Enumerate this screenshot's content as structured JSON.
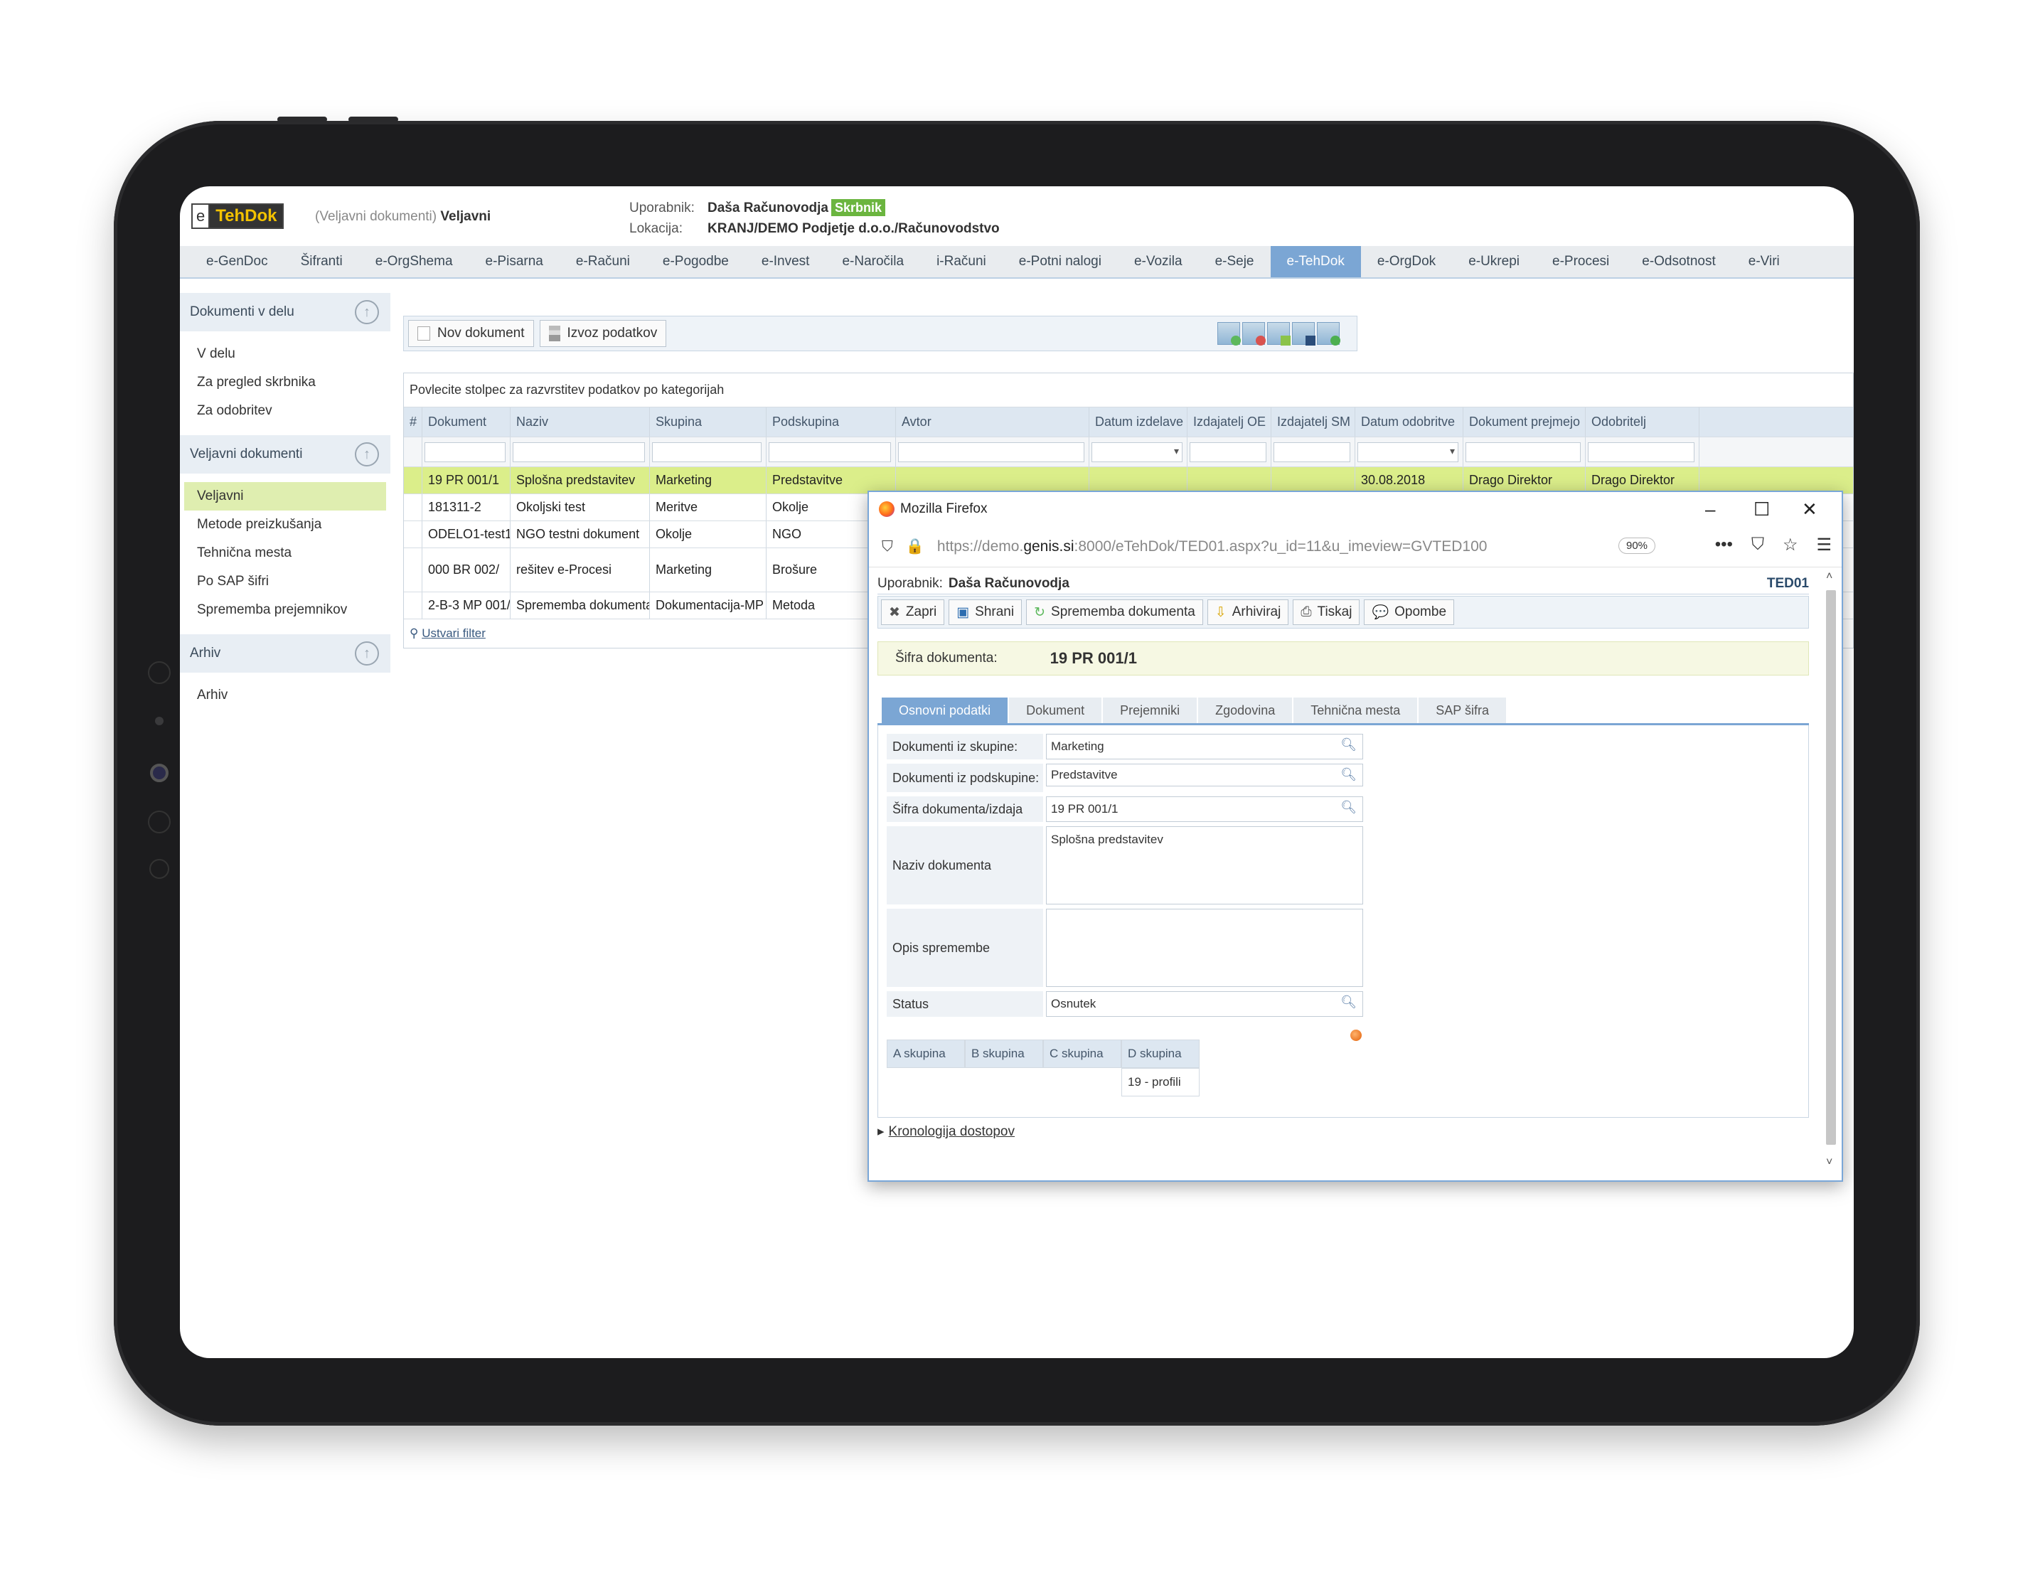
{
  "header": {
    "logo_e": "e",
    "logo_text": "TehDok",
    "context_prefix": "(Veljavni dokumenti)",
    "context_title": "Veljavni",
    "user_label": "Uporabnik:",
    "user_name": "Daša Računovodja",
    "user_role": "Skrbnik",
    "location_label": "Lokacija:",
    "location_value": "KRANJ/DEMO Podjetje d.o.o./Računovodstvo"
  },
  "menu": [
    "e-GenDoc",
    "Šifranti",
    "e-OrgShema",
    "e-Pisarna",
    "e-Računi",
    "e-Pogodbe",
    "e-Invest",
    "e-Naročila",
    "i-Računi",
    "e-Potni nalogi",
    "e-Vozila",
    "e-Seje",
    "e-TehDok",
    "e-OrgDok",
    "e-Ukrepi",
    "e-Procesi",
    "e-Odsotnost",
    "e-Viri"
  ],
  "active_menu": "e-TehDok",
  "sidebar": {
    "sections": [
      {
        "title": "Dokumenti v delu",
        "items": [
          "V delu",
          "Za pregled skrbnika",
          "Za odobritev"
        ]
      },
      {
        "title": "Veljavni dokumenti",
        "items": [
          "Veljavni",
          "Metode preizkušanja",
          "Tehnična mesta",
          "Po SAP šifri",
          "Sprememba prejemnikov"
        ]
      },
      {
        "title": "Arhiv",
        "items": [
          "Arhiv"
        ]
      }
    ],
    "active_item": "Veljavni"
  },
  "toolbar": {
    "new_doc": "Nov dokument",
    "export": "Izvoz podatkov"
  },
  "grid": {
    "group_hint": "Povlecite stolpec za razvrstitev podatkov po kategorijah",
    "columns": [
      "#",
      "Dokument",
      "Naziv",
      "Skupina",
      "Podskupina",
      "Avtor",
      "Datum izdelave",
      "Izdajatelj OE",
      "Izdajatelj SM",
      "Datum odobritve",
      "Dokument prejmejo",
      "Odobritelj"
    ],
    "rows": [
      [
        "",
        "19 PR 001/1",
        "Splošna predstavitev",
        "Marketing",
        "Predstavitve",
        "",
        "",
        "",
        "",
        "30.08.2018",
        "Drago Direktor",
        "Drago Direktor"
      ],
      [
        "",
        "181311-2",
        "Okoljski test",
        "Meritve",
        "Okolje",
        "",
        "",
        "",
        "",
        "",
        "",
        ""
      ],
      [
        "",
        "ODELO1-test1",
        "NGO testni dokument",
        "Okolje",
        "NGO",
        "",
        "",
        "",
        "",
        "",
        "",
        ""
      ],
      [
        "",
        "000 BR 002/",
        "rešitev e-Procesi",
        "Marketing",
        "Brošure",
        "",
        "",
        "",
        "",
        "",
        "",
        ""
      ],
      [
        "",
        "2-B-3 MP 001/",
        "Sprememba dokumenta",
        "Dokumentacija-MP",
        "Metoda",
        "",
        "",
        "",
        "",
        "",
        "",
        ""
      ]
    ],
    "filter_link": "Ustvari filter"
  },
  "popup": {
    "window_title": "Mozilla Firefox",
    "url_prefix": "https://demo.",
    "url_domain": "genis.si",
    "url_suffix": ":8000/eTehDok/TED01.aspx?u_id=11&u_imeview=GVTED100",
    "zoom": "90%",
    "user_label": "Uporabnik:",
    "user_name": "Daša Računovodja",
    "form_code": "TED01",
    "buttons": [
      "Zapri",
      "Shrani",
      "Sprememba dokumenta",
      "Arhiviraj",
      "Tiskaj",
      "Opombe"
    ],
    "sifra_label": "Šifra dokumenta:",
    "sifra_value": "19 PR 001/1",
    "tabs": [
      "Osnovni podatki",
      "Dokument",
      "Prejemniki",
      "Zgodovina",
      "Tehnična mesta",
      "SAP šifra"
    ],
    "fields": {
      "skupina_label": "Dokumenti iz skupine:",
      "skupina_value": "Marketing",
      "podskupina_label": "Dokumenti iz podskupine:",
      "podskupina_value": "Predstavitve",
      "sifra_label": "Šifra dokumenta/izdaja",
      "sifra_value": "19 PR 001/1",
      "naziv_label": "Naziv dokumenta",
      "naziv_value": "Splošna predstavitev",
      "opis_label": "Opis spremembe",
      "opis_value": "",
      "status_label": "Status",
      "status_value": "Osnutek"
    },
    "groups": {
      "headers": [
        "A skupina",
        "B skupina",
        "C skupina",
        "D skupina"
      ],
      "d_value": "19 - profili"
    },
    "kronologija": "Kronologija dostopov"
  }
}
